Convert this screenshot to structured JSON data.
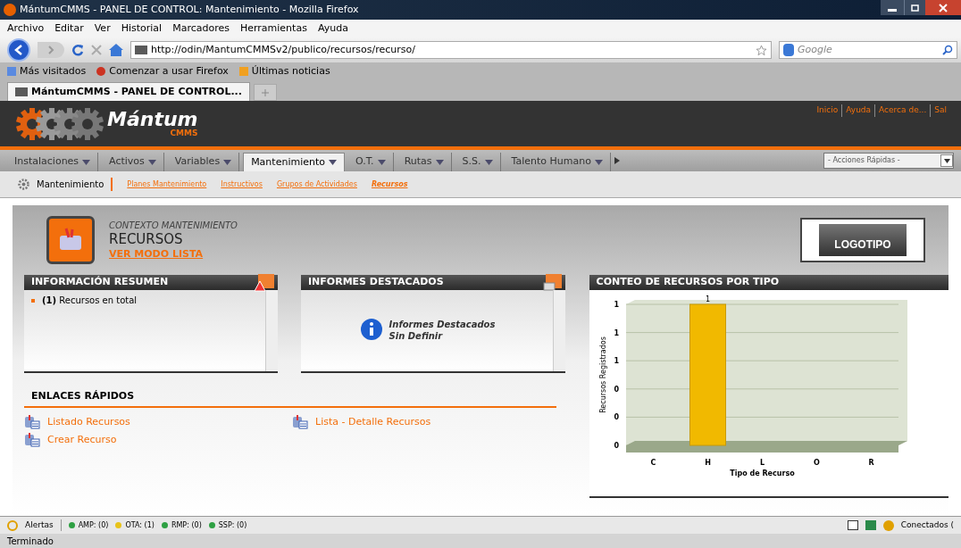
{
  "window": {
    "title": "MántumCMMS - PANEL DE CONTROL: Mantenimiento - Mozilla Firefox"
  },
  "menu_bar": [
    "Archivo",
    "Editar",
    "Ver",
    "Historial",
    "Marcadores",
    "Herramientas",
    "Ayuda"
  ],
  "address_bar": {
    "value": "http://odin/MantumCMMSv2/publico/recursos/recurso/"
  },
  "search": {
    "placeholder": "Google"
  },
  "bookmarks": [
    "Más visitados",
    "Comenzar a usar Firefox",
    "Últimas noticias"
  ],
  "tabs": [
    {
      "label": "MántumCMMS - PANEL DE CONTROL...",
      "selected": true
    }
  ],
  "app_header": {
    "logo": "Mántum",
    "logo_sub": "CMMS",
    "links": [
      "Inicio",
      "Ayuda",
      "Acerca de...",
      "Sal"
    ]
  },
  "main_nav": [
    {
      "label": "Instalaciones",
      "selected": false
    },
    {
      "label": "Activos",
      "selected": false
    },
    {
      "label": "Variables",
      "selected": false
    },
    {
      "label": "Mantenimiento",
      "selected": true
    },
    {
      "label": "O.T.",
      "selected": false
    },
    {
      "label": "Rutas",
      "selected": false
    },
    {
      "label": "S.S.",
      "selected": false
    },
    {
      "label": "Talento Humano",
      "selected": false
    }
  ],
  "quick_actions": {
    "value": "- Acciones Rápidas -"
  },
  "sub_nav": {
    "title": "Mantenimiento",
    "links": [
      {
        "label": "Planes Mantenimiento",
        "selected": false
      },
      {
        "label": "Instructivos",
        "selected": false
      },
      {
        "label": "Grupos de Actividades",
        "selected": false
      },
      {
        "label": "Recursos",
        "selected": true
      }
    ]
  },
  "context": {
    "label": "CONTEXTO MANTENIMIENTO",
    "title": "RECURSOS",
    "link": "VER MODO LISTA",
    "logo": "LOGOTIPO"
  },
  "summary_panel": {
    "title": "INFORMACIÓN RESUMEN",
    "items": [
      "**(1)** Recursos en total"
    ]
  },
  "reports_panel": {
    "title": "INFORMES DESTACADOS",
    "message": [
      "Informes Destacados",
      "Sin Definir"
    ]
  },
  "quick_links": {
    "title": "ENLACES RÁPIDOS",
    "links": [
      "Listado Recursos",
      "Lista - Detalle Recursos",
      "Crear Recurso"
    ]
  },
  "chart_panel": {
    "title": "CONTEO DE RECURSOS POR TIPO",
    "chart_data": {
      "type": "bar",
      "xlabel": "Tipo de Recurso",
      "ylabel": "Recursos Registrados",
      "categories": [
        "C",
        "H",
        "L",
        "O",
        "R"
      ],
      "values": [
        0,
        1,
        0,
        0,
        0
      ],
      "value_labels": [
        null,
        "1",
        null,
        null,
        null
      ],
      "grid": true,
      "ylim": [
        0,
        1
      ],
      "yticks": [
        {
          "value": 0,
          "label": "0"
        },
        {
          "value": 0.2,
          "label": "0"
        },
        {
          "value": 0.4,
          "label": "0"
        },
        {
          "value": 0.6,
          "label": "1"
        },
        {
          "value": 0.8,
          "label": "1"
        },
        {
          "value": 1,
          "label": "1"
        }
      ]
    }
  },
  "status_bar": {
    "alerts": "Alertas",
    "items": [
      {
        "label": "AMP: (0)",
        "color": "#2ea043"
      },
      {
        "label": "OTA: (1)",
        "color": "#e8c31a"
      },
      {
        "label": "RMP: (0)",
        "color": "#2ea043"
      },
      {
        "label": "SSP: (0)",
        "color": "#2ea043"
      }
    ],
    "connected": "Conectados (",
    "text": "Terminado"
  }
}
